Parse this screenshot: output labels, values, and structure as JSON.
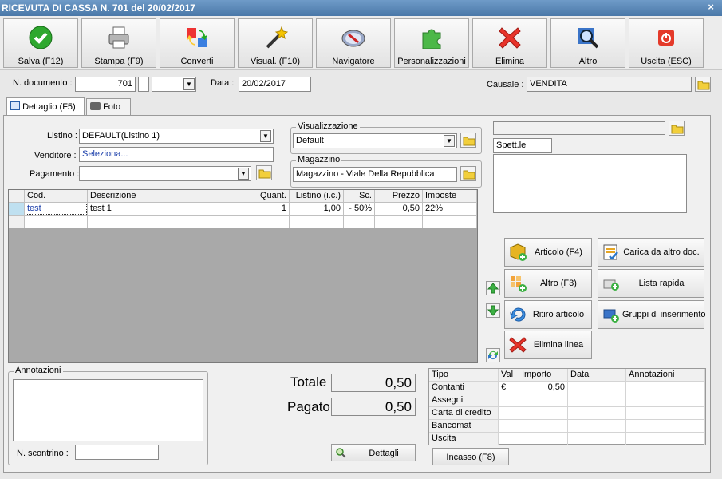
{
  "window": {
    "title": "RICEVUTA DI CASSA N. 701 del 20/02/2017",
    "close": "×"
  },
  "toolbar": [
    {
      "label": "Salva (F12)",
      "icon": "check-icon"
    },
    {
      "label": "Stampa (F9)",
      "icon": "printer-icon"
    },
    {
      "label": "Converti",
      "icon": "convert-icon"
    },
    {
      "label": "Visual. (F10)",
      "icon": "magic-wand-icon"
    },
    {
      "label": "Navigatore",
      "icon": "compass-icon"
    },
    {
      "label": "Personalizzazioni",
      "icon": "puzzle-icon"
    },
    {
      "label": "Elimina",
      "icon": "x-delete-icon"
    },
    {
      "label": "Altro",
      "icon": "magnifier-icon"
    },
    {
      "label": "Uscita (ESC)",
      "icon": "power-icon"
    }
  ],
  "header": {
    "doc_label": "N. documento :",
    "doc_number": "701",
    "date_label": "Data :",
    "date": "20/02/2017",
    "causale_label": "Causale :",
    "causale": "VENDITA"
  },
  "tabs": [
    {
      "label": "Dettaglio (F5)"
    },
    {
      "label": "Foto"
    }
  ],
  "form": {
    "listino_label": "Listino :",
    "listino": "DEFAULT(Listino 1)",
    "venditore_label": "Venditore :",
    "venditore": "Seleziona...",
    "pagamento_label": "Pagamento :",
    "pagamento": "",
    "visualizzazione_label": "Visualizzazione",
    "visualizzazione": "Default",
    "magazzino_label": "Magazzino",
    "magazzino": "Magazzino - Viale Della Repubblica",
    "cliente": "",
    "spett": "Spett.le",
    "indirizzo": ""
  },
  "grid": {
    "columns": [
      "Cod.",
      "Descrizione",
      "Quant.",
      "Listino (i.c.)",
      "Sc.",
      "Prezzo",
      "Imposte"
    ],
    "rows": [
      [
        "test",
        "test 1",
        "1",
        "1,00",
        "- 50%",
        "0,50",
        "22%"
      ]
    ]
  },
  "actions": {
    "articolo": "Articolo (F4)",
    "carica": "Carica da altro doc.",
    "altro": "Altro (F3)",
    "lista": "Lista rapida",
    "ritiro": "Ritiro articolo",
    "gruppi": "Gruppi di inserimento",
    "elimina": "Elimina linea"
  },
  "footer": {
    "annotazioni_label": "Annotazioni",
    "annotazioni": "",
    "scontrino_label": "N. scontrino :",
    "scontrino": "",
    "totale_label": "Totale",
    "totale": "0,50",
    "pagato_label": "Pagato",
    "pagato": "0,50",
    "dettagli": "Dettagli",
    "incasso": "Incasso (F8)"
  },
  "payments": {
    "columns": [
      "Tipo",
      "Val",
      "Importo",
      "Data",
      "Annotazioni"
    ],
    "rows": [
      {
        "tipo": "Contanti",
        "val": "€",
        "importo": "0,50"
      },
      {
        "tipo": "Assegni",
        "val": "",
        "importo": ""
      },
      {
        "tipo": "Carta di credito",
        "val": "",
        "importo": ""
      },
      {
        "tipo": "Bancomat",
        "val": "",
        "importo": ""
      },
      {
        "tipo": "Uscita",
        "val": "",
        "importo": ""
      }
    ]
  }
}
